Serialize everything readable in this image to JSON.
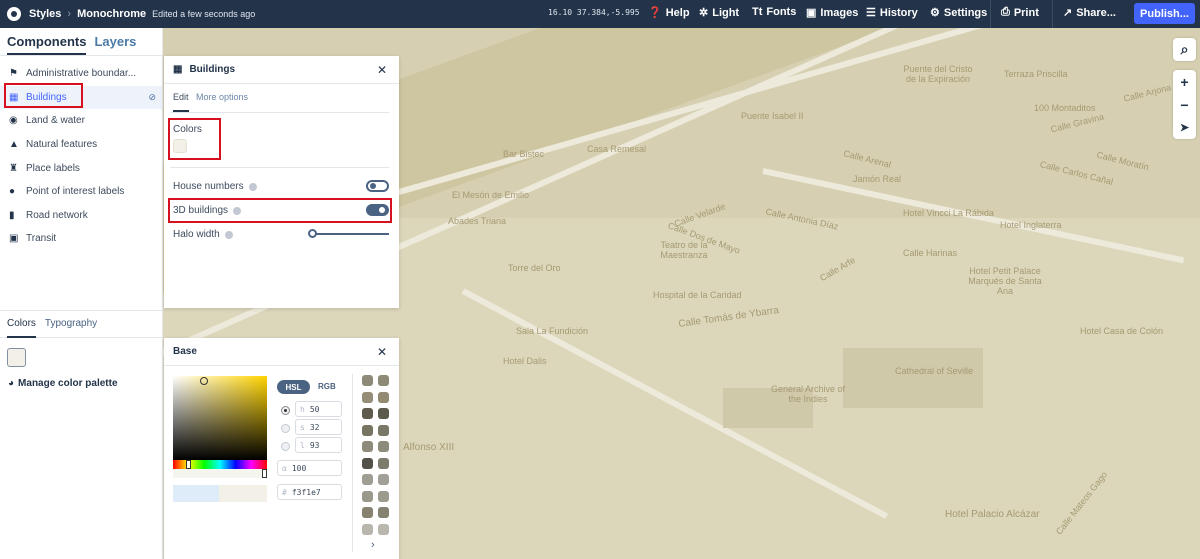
{
  "topbar": {
    "styles": "Styles",
    "style_name": "Monochrome",
    "edited": "Edited a few seconds ago",
    "coords": "16.10 37.384,-5.995",
    "buttons": [
      {
        "label": "Help",
        "icon": "help-icon"
      },
      {
        "label": "Light",
        "icon": "sun-icon"
      },
      {
        "label": "Fonts",
        "icon": "fonts-icon"
      },
      {
        "label": "Images",
        "icon": "image-icon"
      },
      {
        "label": "History",
        "icon": "history-icon"
      },
      {
        "label": "Settings",
        "icon": "gear-icon"
      },
      {
        "label": "Print",
        "icon": "print-icon"
      },
      {
        "label": "Share...",
        "icon": "share-icon"
      }
    ],
    "publish": "Publish..."
  },
  "sidebar": {
    "tabs": [
      "Components",
      "Layers"
    ],
    "items": [
      "Administrative boundar...",
      "Buildings",
      "Land & water",
      "Natural features",
      "Place labels",
      "Point of interest labels",
      "Road network",
      "Transit"
    ]
  },
  "colors_panel": {
    "tabs": [
      "Colors",
      "Typography"
    ],
    "swatch": "#f3f1e7",
    "manage": "Manage color palette"
  },
  "buildings_panel": {
    "title": "Buildings",
    "tabs": [
      "Edit",
      "More options"
    ],
    "colors_label": "Colors",
    "swatch": "#f3f1e7",
    "house_numbers": "House numbers",
    "house_numbers_on": false,
    "buildings_3d": "3D buildings",
    "buildings_3d_on": true,
    "halo_width": "Halo width",
    "halo_value": 0
  },
  "base_panel": {
    "title": "Base",
    "modes": [
      "HSL",
      "RGB"
    ],
    "h_label": "h",
    "h": "50",
    "s_label": "s",
    "s": "32",
    "l_label": "l",
    "l": "93",
    "alpha_label": "α",
    "alpha": "100",
    "hex_label": "#",
    "hex": "f3f1e7",
    "palette": [
      "#8e8a79",
      "#8d8a76",
      "#948e78",
      "#928b72",
      "#5e5b4d",
      "#5c5a4b",
      "#777462",
      "#7a7866",
      "#8e8b7a",
      "#8d8b7a",
      "#545248",
      "#7e7c6d",
      "#a09e93",
      "#a2a096",
      "#9b998c",
      "#9d9b8e",
      "#86826f",
      "#848170",
      "#b8b6ad",
      "#b9b7ae"
    ]
  },
  "map": {
    "labels": [
      "Casa Remesal",
      "Bar Bistec",
      "El Mesón de Emilio",
      "Abades Triana",
      "Torre del Oro",
      "Calle Velarde",
      "Calle Dos de Mayo",
      "Teatro de la Maestranza",
      "Hospital de la Caridad",
      "Calle Tomás de Ybarra",
      "Sala La Fundición",
      "Hotel Dalis",
      "Alfonso XIII",
      "General Archive of the Indies",
      "Cathedral of Seville",
      "Calle Arjona",
      "Calle Gravina",
      "Calle Arenal",
      "Jamón Real",
      "Hotel Vincci La Rábida",
      "Hotel Inglaterra",
      "Calle Harinas",
      "Calle Arfe",
      "Hotel Petit Palace Marqués de Santa Ana",
      "Calle Carlos Cañal",
      "Calle Moratín",
      "Hotel Casa de Colón",
      "Hotel Palacio Alcázar",
      "Calle Mateos Gago",
      "Puente Isabel II",
      "Terraza Priscilla",
      "100 Montaditos",
      "Calle Antonia Díaz",
      "Puente del Cristo de la Expiración"
    ]
  }
}
